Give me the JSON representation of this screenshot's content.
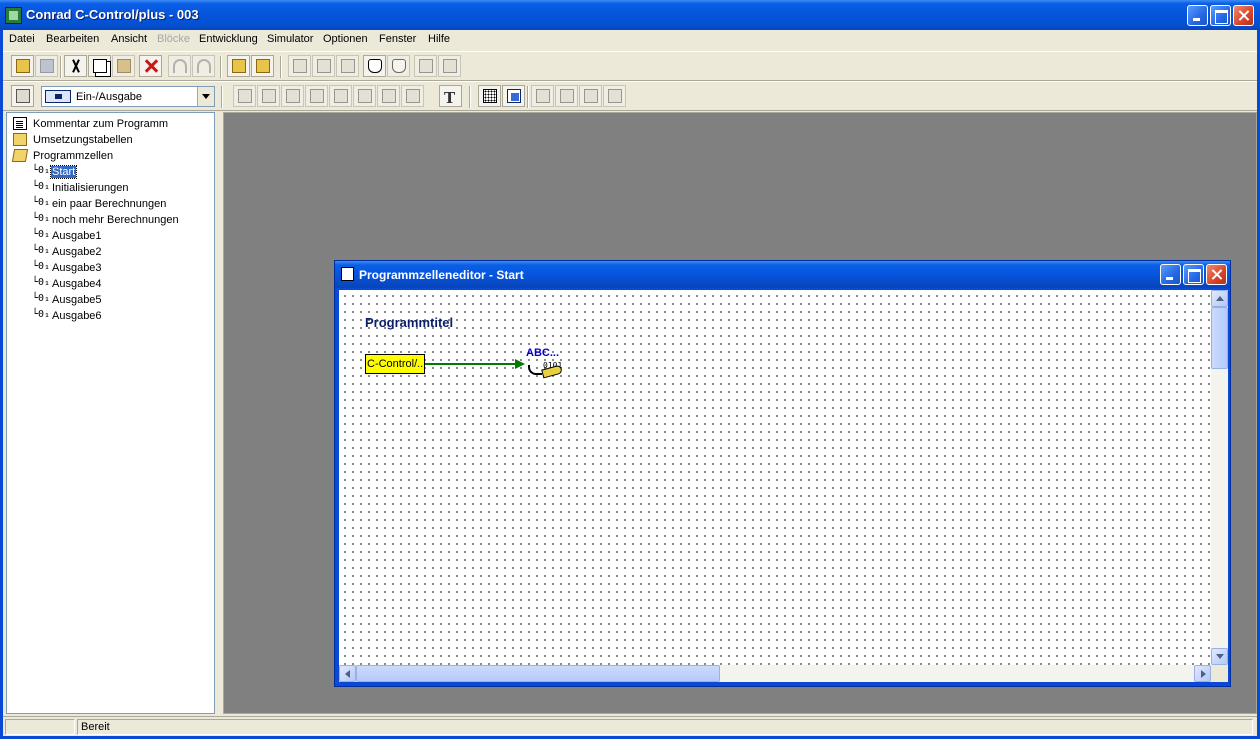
{
  "window": {
    "title": "Conrad C-Control/plus - 003",
    "icon": "c-control-app-icon"
  },
  "menu": {
    "items": [
      "Datei",
      "Bearbeiten",
      "Ansicht",
      "Blöcke",
      "Entwicklung",
      "Simulator",
      "Optionen",
      "Fenster",
      "Hilfe"
    ],
    "disabled": [
      "Blöcke"
    ]
  },
  "toolbar": {
    "block_category_select": "Ein-/Ausgabe",
    "icons": [
      "open-icon",
      "save-icon",
      "cut-icon",
      "copy-icon",
      "paste-icon",
      "delete-icon",
      "undo-icon",
      "redo-icon",
      "compile-icon",
      "transfer-icon",
      "hand-icon",
      "text-tool-icon",
      "grid-icon",
      "snap-grid-icon"
    ],
    "text_tool_glyph": "T"
  },
  "tree": {
    "root_items": [
      {
        "label": "Kommentar zum Programm",
        "icon": "document-icon"
      },
      {
        "label": "Umsetzungstabellen",
        "icon": "folder-icon"
      },
      {
        "label": "Programmzellen",
        "icon": "folder-open-icon"
      }
    ],
    "cells": [
      {
        "label": "Start",
        "selected": true
      },
      {
        "label": "Initialisierungen"
      },
      {
        "label": "ein paar Berechnungen"
      },
      {
        "label": "noch mehr Berechnungen"
      },
      {
        "label": "Ausgabe1"
      },
      {
        "label": "Ausgabe2"
      },
      {
        "label": "Ausgabe3"
      },
      {
        "label": "Ausgabe4"
      },
      {
        "label": "Ausgabe5"
      },
      {
        "label": "Ausgabe6"
      }
    ],
    "cell_glyph": "└0₁"
  },
  "editor": {
    "title": "Programmzelleneditor - Start",
    "program_title": "Programmtitel",
    "input_block": "C-Control/...",
    "output_label": "ABC...",
    "output_digits": "0101",
    "colors": {
      "input_block": "#ffff00",
      "wire": "#007a00",
      "output_label": "#0000c8"
    }
  },
  "statusbar": {
    "first_pane": "",
    "status": "Bereit"
  },
  "colors": {
    "titlebar": "#0654dc",
    "selection": "#316ac5",
    "mdi_background": "#808080"
  }
}
